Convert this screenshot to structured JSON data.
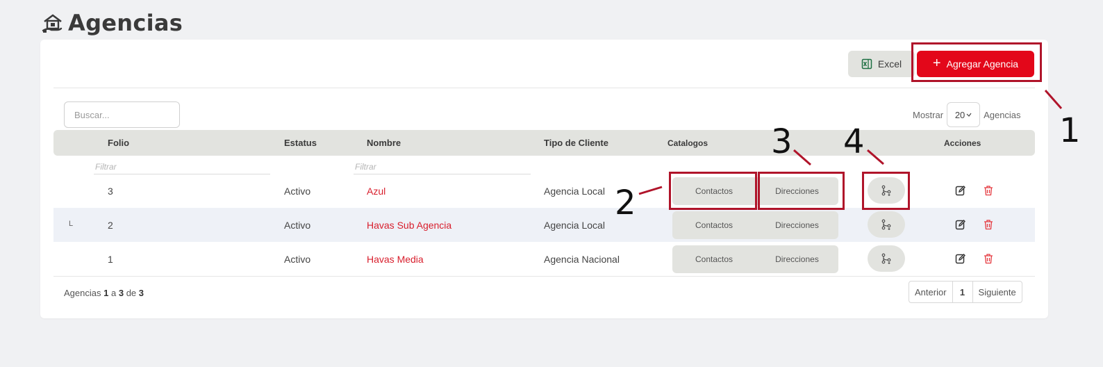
{
  "page": {
    "title": "Agencias",
    "title_icon": "agency-building-icon"
  },
  "toolbar": {
    "excel_label": "Excel",
    "add_label": "Agregar Agencia",
    "brand_color": "#e3071a"
  },
  "search": {
    "placeholder": "Buscar..."
  },
  "page_size": {
    "prefix": "Mostrar",
    "value": "20",
    "suffix": "Agencias"
  },
  "table": {
    "headers": {
      "folio": "Folio",
      "estatus": "Estatus",
      "nombre": "Nombre",
      "tipo": "Tipo de Cliente",
      "catalogos": "Catalogos",
      "acciones": "Acciones"
    },
    "filter_placeholder": "Filtrar",
    "rows": [
      {
        "child_marker": "",
        "folio": "3",
        "estatus": "Activo",
        "nombre": "Azul",
        "tipo": "Agencia Local",
        "contactos": "Contactos",
        "direcciones": "Direcciones"
      },
      {
        "child_marker": "L",
        "folio": "2",
        "estatus": "Activo",
        "nombre": "Havas Sub Agencia",
        "tipo": "Agencia Local",
        "contactos": "Contactos",
        "direcciones": "Direcciones"
      },
      {
        "child_marker": "",
        "folio": "1",
        "estatus": "Activo",
        "nombre": "Havas Media",
        "tipo": "Agencia Nacional",
        "contactos": "Contactos",
        "direcciones": "Direcciones"
      }
    ]
  },
  "footer": {
    "prefix": "Agencias",
    "from": "1",
    "a": "a",
    "to": "3",
    "de": "de",
    "total": "3"
  },
  "pagination": {
    "prev": "Anterior",
    "current": "1",
    "next": "Siguiente"
  },
  "annotations": {
    "color": "#b0142a",
    "labels": [
      "1",
      "2",
      "3",
      "4"
    ]
  }
}
